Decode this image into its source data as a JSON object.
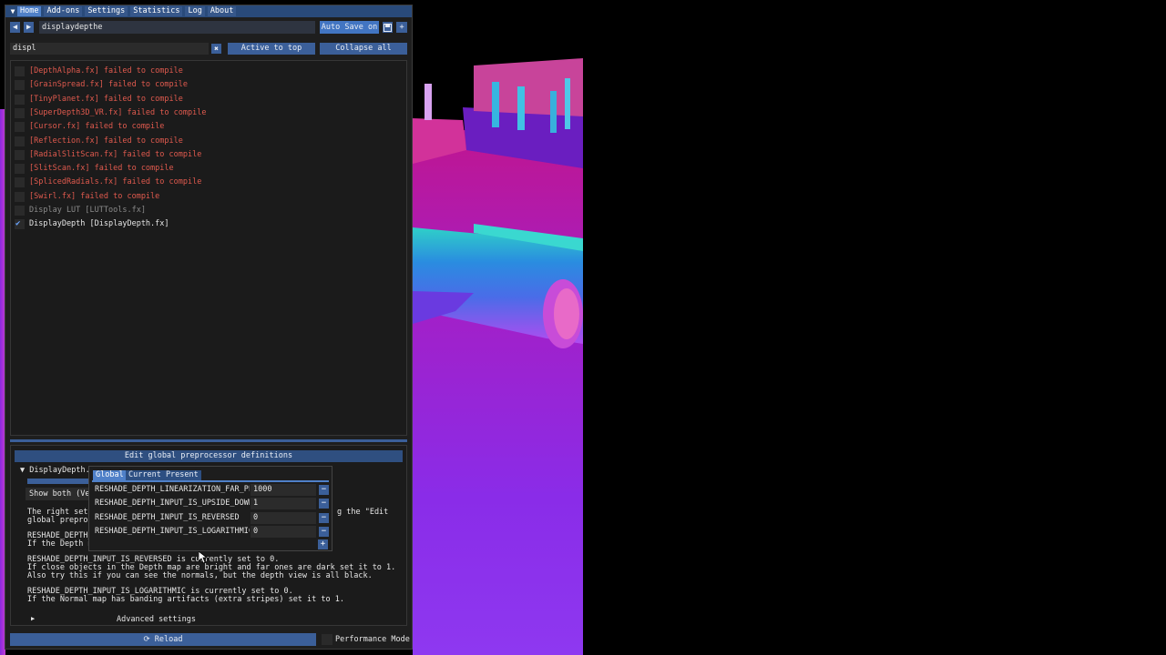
{
  "menu": {
    "collapse_glyph": "▼",
    "items": [
      "Home",
      "Add-ons",
      "Settings",
      "Statistics",
      "Log",
      "About"
    ],
    "active": "Home"
  },
  "preset_bar": {
    "prev_glyph": "◀",
    "next_glyph": "▶",
    "preset_name": "displaydepthe",
    "auto_save_label": "Auto Save on",
    "save_icon": "floppy-icon",
    "add_glyph": "+"
  },
  "filter_bar": {
    "search_value": "displ",
    "clear_glyph": "✖",
    "active_to_top_label": "Active to top",
    "collapse_all_label": "Collapse all"
  },
  "effects": [
    {
      "label": "[DepthAlpha.fx] failed to compile",
      "state": "error",
      "checked": false
    },
    {
      "label": "[GrainSpread.fx] failed to compile",
      "state": "error",
      "checked": false
    },
    {
      "label": "[TinyPlanet.fx] failed to compile",
      "state": "error",
      "checked": false
    },
    {
      "label": "[SuperDepth3D_VR.fx] failed to compile",
      "state": "error",
      "checked": false
    },
    {
      "label": "[Cursor.fx] failed to compile",
      "state": "error",
      "checked": false
    },
    {
      "label": "[Reflection.fx] failed to compile",
      "state": "error",
      "checked": false
    },
    {
      "label": "[RadialSlitScan.fx] failed to compile",
      "state": "error",
      "checked": false
    },
    {
      "label": "[SlitScan.fx] failed to compile",
      "state": "error",
      "checked": false
    },
    {
      "label": "[SplicedRadials.fx] failed to compile",
      "state": "error",
      "checked": false
    },
    {
      "label": "[Swirl.fx] failed to compile",
      "state": "error",
      "checked": false
    },
    {
      "label": "Display LUT [LUTTools.fx]",
      "state": "disabled",
      "checked": false
    },
    {
      "label": "DisplayDepth [DisplayDepth.fx]",
      "state": "enabled",
      "checked": true
    }
  ],
  "settings": {
    "edit_defs_label": "Edit global preprocessor definitions",
    "section_title": "DisplayDepth.f",
    "show_both_label": "Show both (Ver",
    "help_line1_left": "The right sett",
    "help_line1_right": "g the \"Edit",
    "help_line2": "global preproc",
    "upside_down_line1": "RESHADE_DEPTH_",
    "upside_down_line2": "If the Depth m",
    "reversed_line1": "RESHADE_DEPTH_INPUT_IS_REVERSED is currently set to 0.",
    "reversed_line2": "If close objects in the Depth map are bright and far ones are dark set it to 1.",
    "reversed_line3": "Also try this if you can see the normals, but the depth view is all black.",
    "log_line1": "RESHADE_DEPTH_INPUT_IS_LOGARITHMIC is currently set to 0.",
    "log_line2": "If the Normal map has banding artifacts (extra stripes) set it to 1.",
    "advanced_label": "Advanced settings",
    "advanced_glyph": "▶"
  },
  "popup": {
    "tabs": [
      "Global",
      "Current Present"
    ],
    "active_tab": "Global",
    "definitions": [
      {
        "name": "RESHADE_DEPTH_LINEARIZATION_FAR_PLANE",
        "value": "1000"
      },
      {
        "name": "RESHADE_DEPTH_INPUT_IS_UPSIDE_DOWN",
        "value": "1"
      },
      {
        "name": "RESHADE_DEPTH_INPUT_IS_REVERSED",
        "value": "0"
      },
      {
        "name": "RESHADE_DEPTH_INPUT_IS_LOGARITHMIC",
        "value": "0"
      }
    ],
    "remove_glyph": "−",
    "add_glyph": "+"
  },
  "footer": {
    "reload_label": "Reload",
    "reload_icon": "refresh-icon",
    "performance_mode_label": "Performance Mode"
  },
  "colors": {
    "accent": "#4f80c8",
    "button": "#3b5f99",
    "error_text": "#e05a4e",
    "window_bg": "#1e1e1e"
  }
}
